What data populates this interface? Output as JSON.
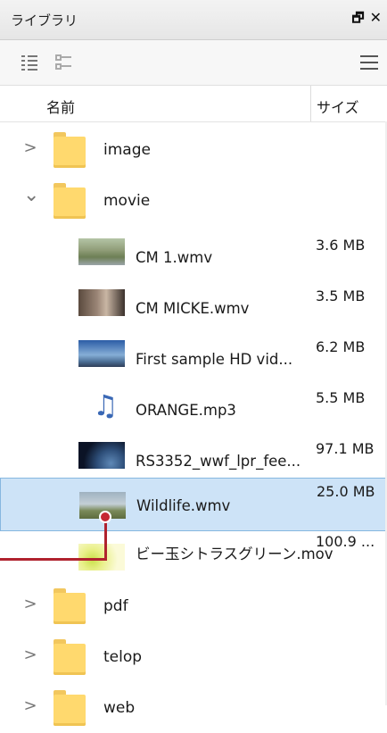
{
  "panel": {
    "title": "ライブラリ",
    "float_glyph": "🗗",
    "close_glyph": "✕"
  },
  "toolbar": {
    "icons": [
      "detail-view-icon",
      "thumbnail-view-icon",
      "menu-icon"
    ]
  },
  "columns": {
    "name": "名前",
    "size": "サイズ"
  },
  "folders_top": [
    {
      "name": "image",
      "expanded": false,
      "chevron": ">"
    },
    {
      "name": "movie",
      "expanded": true,
      "chevron": "⌄"
    }
  ],
  "files": [
    {
      "name": "CM 1.wmv",
      "size": "3.6 MB",
      "thumb": "landscape",
      "selected": false
    },
    {
      "name": "CM MICKE.wmv",
      "size": "3.5 MB",
      "thumb": "portrait",
      "selected": false
    },
    {
      "name": "First sample HD vid...",
      "size": "6.2 MB",
      "thumb": "sky",
      "selected": false
    },
    {
      "name": "ORANGE.mp3",
      "size": "5.5 MB",
      "thumb": "music",
      "selected": false
    },
    {
      "name": "RS3352_wwf_lpr_fee...",
      "size": "97.1 MB",
      "thumb": "earth",
      "selected": false
    },
    {
      "name": "Wildlife.wmv",
      "size": "25.0 MB",
      "thumb": "wildlife",
      "selected": true
    },
    {
      "name": "ビー玉シトラスグリーン.mov",
      "size": "100.9 ...",
      "thumb": "marble",
      "selected": false
    }
  ],
  "folders_bottom": [
    {
      "name": "pdf",
      "chevron": ">"
    },
    {
      "name": "telop",
      "chevron": ">"
    },
    {
      "name": "web",
      "chevron": ">"
    }
  ],
  "colors": {
    "selection_bg": "#cde3f7",
    "selection_border": "#86b7e0",
    "annotation": "#b0222e",
    "folder": "#ffd96e"
  }
}
